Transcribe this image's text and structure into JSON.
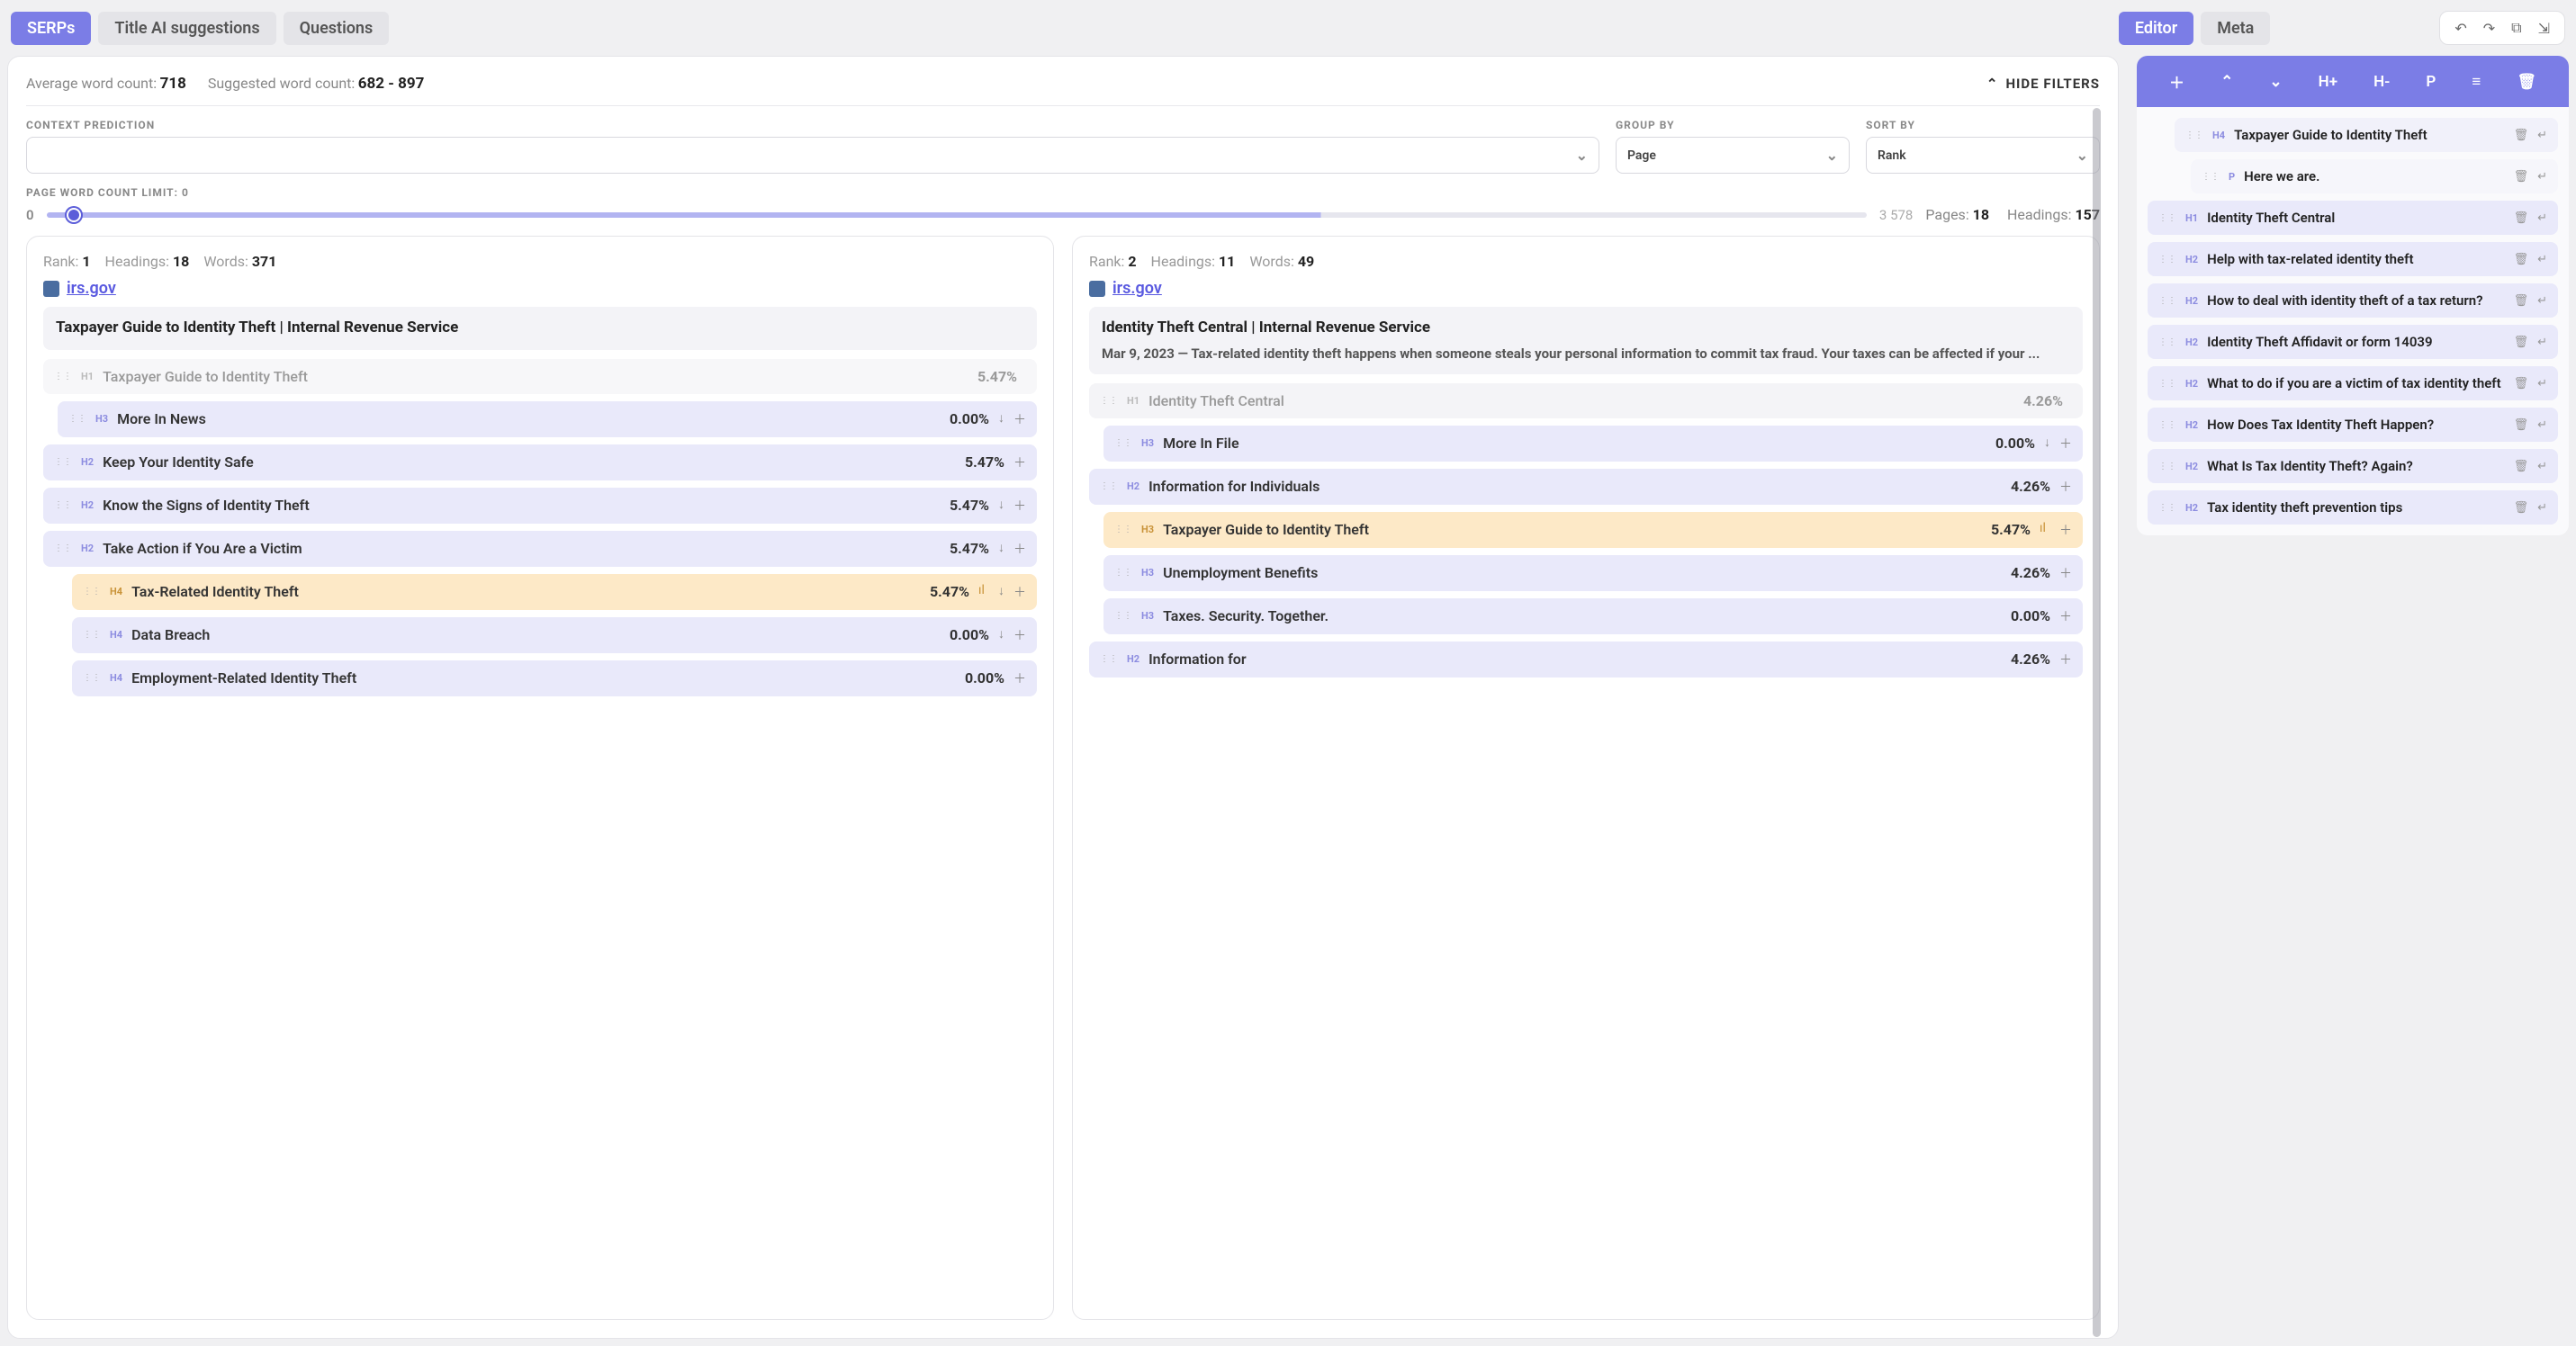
{
  "tabs": {
    "main": [
      "SERPs",
      "Title AI suggestions",
      "Questions"
    ],
    "main_active": 0,
    "editor": [
      "Editor",
      "Meta"
    ],
    "editor_active": 0
  },
  "stats": {
    "avg_label": "Average word count:",
    "avg_value": "718",
    "suggested_label": "Suggested word count:",
    "suggested_value": "682 - 897",
    "hide_filters": "HIDE  FILTERS"
  },
  "filters": {
    "context_label": "CONTEXT PREDICTION",
    "context_value": "",
    "groupby_label": "GROUP BY",
    "groupby_value": "Page",
    "sortby_label": "SORT BY",
    "sortby_value": "Rank"
  },
  "slider": {
    "label": "PAGE WORD COUNT LIMIT: 0",
    "min": "0",
    "max": "3 578",
    "pages_label": "Pages:",
    "pages_value": "18",
    "headings_label": "Headings:",
    "headings_value": "157"
  },
  "serps": [
    {
      "rank_label": "Rank:",
      "rank": "1",
      "headings_label": "Headings:",
      "headings": "18",
      "words_label": "Words:",
      "words": "371",
      "domain": "irs.gov",
      "title": "Taxpayer Guide to Identity Theft | Internal Revenue Service",
      "snippet": "",
      "rows": [
        {
          "level": "H1",
          "text": "Taxpayer Guide to Identity Theft",
          "pct": "5.47%",
          "style": "h1",
          "icons": []
        },
        {
          "level": "H3",
          "text": "More In News",
          "pct": "0.00%",
          "style": "h3",
          "icons": [
            "down",
            "plus"
          ]
        },
        {
          "level": "H2",
          "text": "Keep Your Identity Safe",
          "pct": "5.47%",
          "style": "h2",
          "icons": [
            "plus"
          ]
        },
        {
          "level": "H2",
          "text": "Know the Signs of Identity Theft",
          "pct": "5.47%",
          "style": "h2",
          "icons": [
            "down",
            "plus"
          ]
        },
        {
          "level": "H2",
          "text": "Take Action if You Are a Victim",
          "pct": "5.47%",
          "style": "h2",
          "icons": [
            "down",
            "plus"
          ]
        },
        {
          "level": "H4",
          "text": "Tax-Related Identity Theft",
          "pct": "5.47%",
          "style": "h4 highlight",
          "icons": [
            "bars",
            "down",
            "plus"
          ]
        },
        {
          "level": "H4",
          "text": "Data Breach",
          "pct": "0.00%",
          "style": "h4",
          "icons": [
            "down",
            "plus"
          ]
        },
        {
          "level": "H4",
          "text": "Employment-Related Identity Theft",
          "pct": "0.00%",
          "style": "h4",
          "icons": [
            "plus"
          ]
        }
      ]
    },
    {
      "rank_label": "Rank:",
      "rank": "2",
      "headings_label": "Headings:",
      "headings": "11",
      "words_label": "Words:",
      "words": "49",
      "domain": "irs.gov",
      "title": "Identity Theft Central | Internal Revenue Service",
      "snippet": "Mar 9, 2023 — Tax-related identity theft happens when someone steals your personal information to commit tax fraud. Your taxes can be affected if your ...",
      "rows": [
        {
          "level": "H1",
          "text": "Identity Theft Central",
          "pct": "4.26%",
          "style": "h1 muted",
          "icons": []
        },
        {
          "level": "H3",
          "text": "More In File",
          "pct": "0.00%",
          "style": "h3",
          "icons": [
            "down",
            "plus"
          ]
        },
        {
          "level": "H2",
          "text": "Information for Individuals",
          "pct": "4.26%",
          "style": "h2",
          "icons": [
            "plus"
          ]
        },
        {
          "level": "H3",
          "text": "Taxpayer Guide to Identity Theft",
          "pct": "5.47%",
          "style": "h3 highlight",
          "icons": [
            "bars",
            "plus"
          ]
        },
        {
          "level": "H3",
          "text": "Unemployment Benefits",
          "pct": "4.26%",
          "style": "h3",
          "icons": [
            "plus"
          ]
        },
        {
          "level": "H3",
          "text": "Taxes. Security. Together.",
          "pct": "0.00%",
          "style": "h3",
          "icons": [
            "plus"
          ]
        },
        {
          "level": "H2",
          "text": "Information for",
          "pct": "4.26%",
          "style": "h2",
          "icons": [
            "plus"
          ]
        }
      ]
    }
  ],
  "editor_toolbar": {
    "items": [
      "plus",
      "up",
      "down",
      "H+",
      "H-",
      "P",
      "list",
      "trash"
    ]
  },
  "outline": [
    {
      "level": "H4",
      "text": "Taxpayer Guide to Identity Theft",
      "indent": "indent4"
    },
    {
      "level": "P",
      "text": "Here we are.",
      "indent": "indentp"
    },
    {
      "level": "H1",
      "text": "Identity Theft Central",
      "indent": "indent1"
    },
    {
      "level": "H2",
      "text": "Help with tax-related identity theft",
      "indent": "indent1"
    },
    {
      "level": "H2",
      "text": "How to deal with identity theft of a tax return?",
      "indent": "indent1"
    },
    {
      "level": "H2",
      "text": "Identity Theft Affidavit or form 14039",
      "indent": "indent1"
    },
    {
      "level": "H2",
      "text": "What to do if you are a victim of tax identity theft",
      "indent": "indent1"
    },
    {
      "level": "H2",
      "text": "How Does Tax Identity Theft Happen?",
      "indent": "indent1"
    },
    {
      "level": "H2",
      "text": "What Is Tax Identity Theft? Again?",
      "indent": "indent1"
    },
    {
      "level": "H2",
      "text": "Tax identity theft prevention tips",
      "indent": "indent1"
    }
  ]
}
